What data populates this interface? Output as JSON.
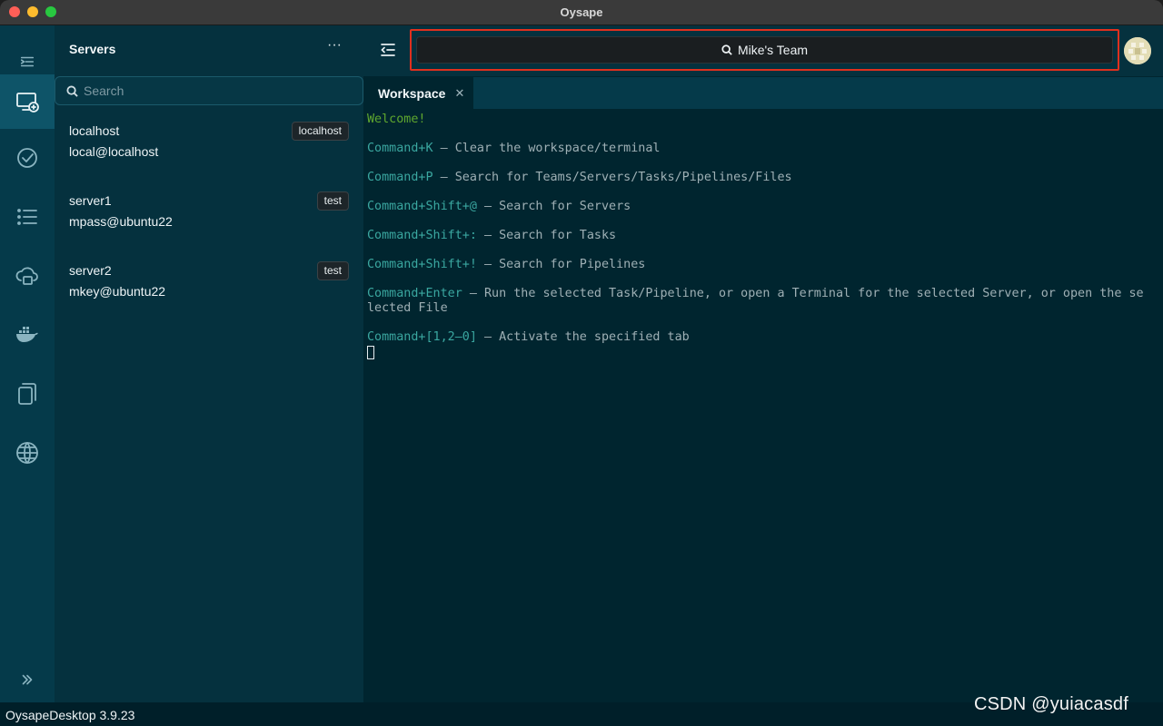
{
  "window": {
    "title": "Oysape"
  },
  "rail": {
    "items": [
      {
        "name": "menu-toggle-icon"
      },
      {
        "name": "servers-icon"
      },
      {
        "name": "tasks-icon"
      },
      {
        "name": "pipelines-icon"
      },
      {
        "name": "cloud-icon"
      },
      {
        "name": "docker-icon"
      },
      {
        "name": "files-icon"
      },
      {
        "name": "web-icon"
      },
      {
        "name": "expand-icon"
      }
    ]
  },
  "servers": {
    "header": "Servers",
    "more_label": "···",
    "search_placeholder": "Search",
    "items": [
      {
        "name": "localhost",
        "user": "local@localhost",
        "tag": "localhost"
      },
      {
        "name": "server1",
        "user": "mpass@ubuntu22",
        "tag": "test"
      },
      {
        "name": "server2",
        "user": "mkey@ubuntu22",
        "tag": "test"
      }
    ]
  },
  "topbar": {
    "team_label": "Mike's Team"
  },
  "tabs": [
    {
      "label": "Workspace",
      "close": "✕"
    }
  ],
  "terminal": {
    "welcome": "Welcome!",
    "lines": [
      {
        "cmd": "Command+K",
        "desc": " – Clear the workspace/terminal"
      },
      {
        "cmd": "Command+P",
        "desc": " – Search for Teams/Servers/Tasks/Pipelines/Files"
      },
      {
        "cmd": "Command+Shift+@",
        "desc": " – Search for Servers"
      },
      {
        "cmd": "Command+Shift+:",
        "desc": " – Search for Tasks"
      },
      {
        "cmd": "Command+Shift+!",
        "desc": " – Search for Pipelines"
      },
      {
        "cmd": "Command+Enter",
        "desc": " – Run the selected Task/Pipeline, or open a Terminal for the selected Server, or open the selected File"
      },
      {
        "cmd": "Command+[1,2–0]",
        "desc": " – Activate the specified tab"
      }
    ]
  },
  "status": {
    "version": "OysapeDesktop 3.9.23"
  },
  "watermark": "CSDN @yuiacasdf",
  "colors": {
    "accent": "#0e5468",
    "highlight_border": "#e0301e",
    "terminal_bg": "#00252f"
  }
}
